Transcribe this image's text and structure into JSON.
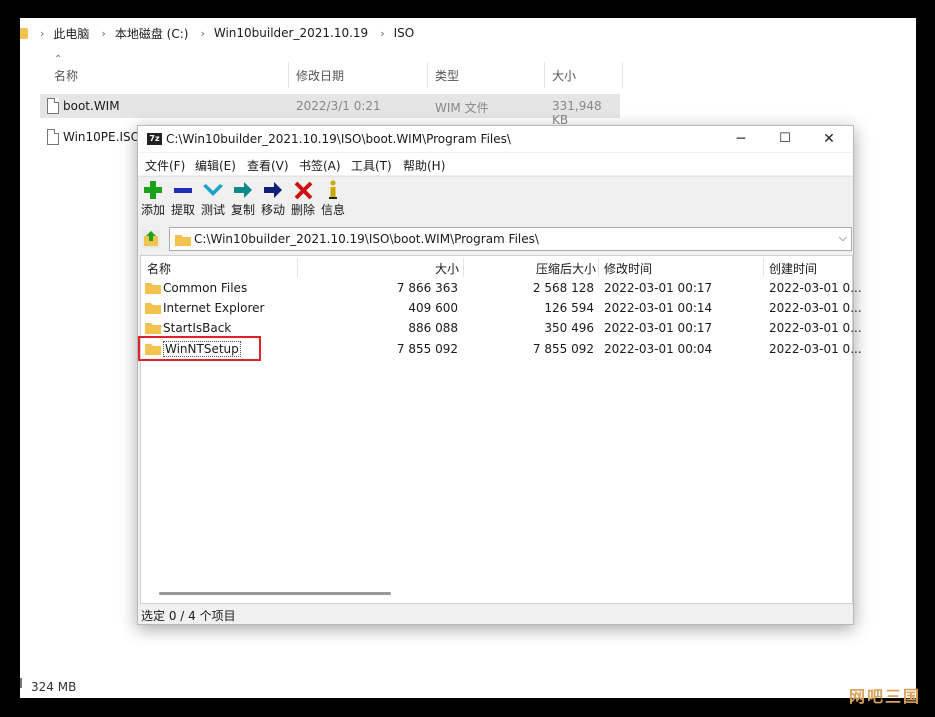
{
  "explorer": {
    "breadcrumb": [
      "此电脑",
      "本地磁盘 (C:)",
      "Win10builder_2021.10.19",
      "ISO"
    ],
    "columns": {
      "name": "名称",
      "modified": "修改日期",
      "type": "类型",
      "size": "大小"
    },
    "files": [
      {
        "name": "boot.WIM",
        "modified": "2022/3/1 0:21",
        "type": "WIM 文件",
        "size": "331,948 KB"
      },
      {
        "name": "Win10PE.ISO"
      }
    ],
    "status": "324 MB"
  },
  "zip": {
    "title": "C:\\Win10builder_2021.10.19\\ISO\\boot.WIM\\Program Files\\",
    "app_icon": "7z",
    "window_controls": {
      "minimize": "─",
      "maximize": "☐",
      "close": "✕"
    },
    "menu": [
      "文件(F)",
      "编辑(E)",
      "查看(V)",
      "书签(A)",
      "工具(T)",
      "帮助(H)"
    ],
    "toolbar": [
      {
        "label": "添加",
        "icon": "add-icon",
        "color": "#1aa31a"
      },
      {
        "label": "提取",
        "icon": "extract-icon",
        "color": "#1e2fb5"
      },
      {
        "label": "测试",
        "icon": "test-icon",
        "color": "#17a5c7"
      },
      {
        "label": "复制",
        "icon": "copy-icon",
        "color": "#0f8a8a"
      },
      {
        "label": "移动",
        "icon": "move-icon",
        "color": "#10207a"
      },
      {
        "label": "删除",
        "icon": "delete-icon",
        "color": "#d01010"
      },
      {
        "label": "信息",
        "icon": "info-icon",
        "color": "#c9a800"
      }
    ],
    "address": "C:\\Win10builder_2021.10.19\\ISO\\boot.WIM\\Program Files\\",
    "columns": {
      "name": "名称",
      "size": "大小",
      "packed": "压缩后大小",
      "modified": "修改时间",
      "created": "创建时间"
    },
    "rows": [
      {
        "name": "Common Files",
        "size": "7 866 363",
        "packed": "2 568 128",
        "modified": "2022-03-01 00:17",
        "created": "2022-03-01 0..."
      },
      {
        "name": "Internet Explorer",
        "size": "409 600",
        "packed": "126 594",
        "modified": "2022-03-01 00:14",
        "created": "2022-03-01 0..."
      },
      {
        "name": "StartIsBack",
        "size": "886 088",
        "packed": "350 496",
        "modified": "2022-03-01 00:17",
        "created": "2022-03-01 0..."
      },
      {
        "name": "WinNTSetup",
        "size": "7 855 092",
        "packed": "7 855 092",
        "modified": "2022-03-01 00:04",
        "created": "2022-03-01 0..."
      }
    ],
    "status": "选定 0 / 4 个项目"
  },
  "watermark": "网吧三国",
  "colors": {
    "folder": "#f4c24f",
    "highlight": "#e0202a"
  }
}
